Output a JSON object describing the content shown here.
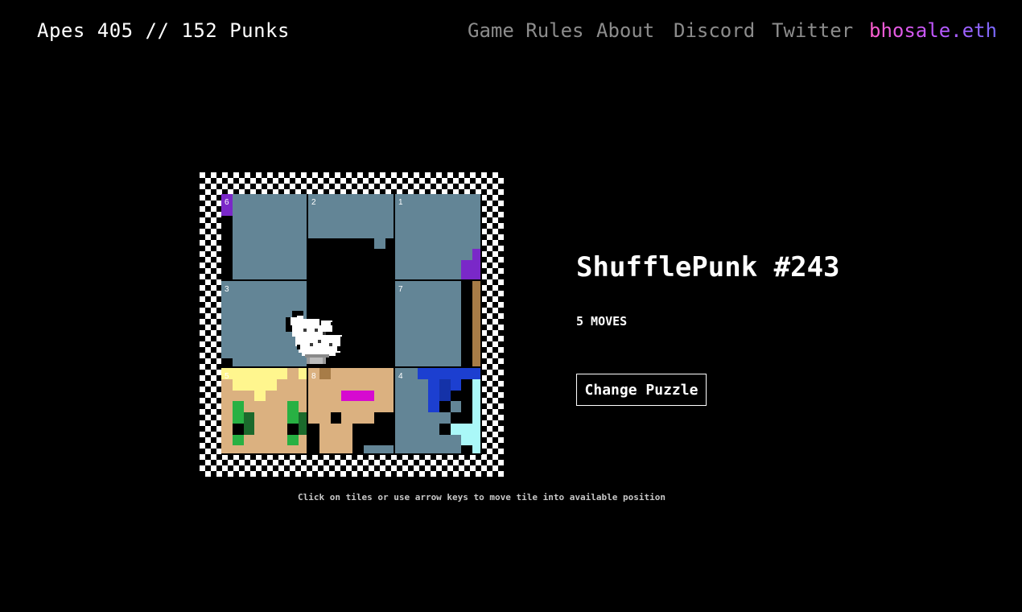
{
  "header": {
    "score": "Apes 405 // 152 Punks",
    "nav": [
      {
        "label": "Game Rules"
      },
      {
        "label": "About"
      },
      {
        "label": "Discord"
      },
      {
        "label": "Twitter"
      },
      {
        "label": "bhosale.eth"
      }
    ]
  },
  "puzzle": {
    "tiles": [
      "6",
      "2",
      "1",
      "3",
      "",
      "7",
      "5",
      "8",
      "4"
    ],
    "hint": "Click on tiles or use arrow keys to move tile into available position"
  },
  "panel": {
    "title": "ShufflePunk #243",
    "moves": "5 MOVES",
    "change_button": "Change Puzzle"
  },
  "colors": {
    "punk_bg": "#638596",
    "skin": "#dbb180",
    "hair": "#fff68e",
    "eyes": "#28b143",
    "lipstick": "#d60ad0",
    "purple": "#7a28c8",
    "blue": "#1c3fd0",
    "ice": "#aaf8f8"
  }
}
